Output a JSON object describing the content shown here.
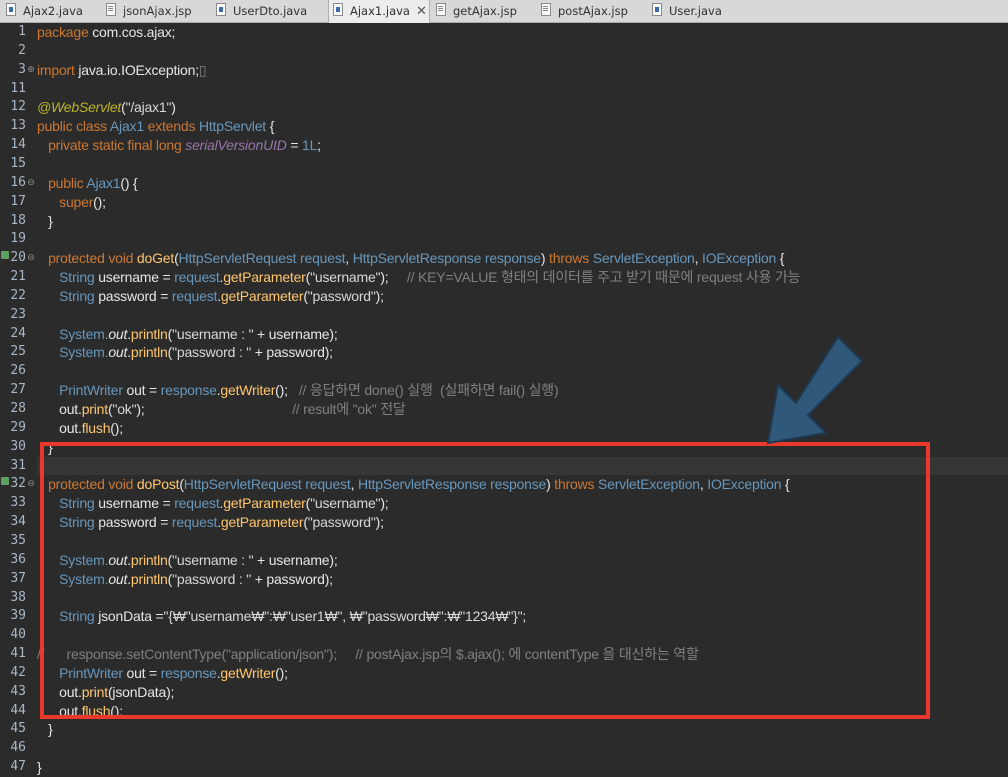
{
  "tabs": [
    {
      "label": "Ajax2.java",
      "icon": "java-file-icon",
      "active": false
    },
    {
      "label": "jsonAjax.jsp",
      "icon": "jsp-file-icon",
      "active": false
    },
    {
      "label": "UserDto.java",
      "icon": "java-file-icon",
      "active": false
    },
    {
      "label": "Ajax1.java",
      "icon": "java-file-icon",
      "active": true
    },
    {
      "label": "getAjax.jsp",
      "icon": "jsp-file-icon",
      "active": false
    },
    {
      "label": "postAjax.jsp",
      "icon": "jsp-file-icon",
      "active": false
    },
    {
      "label": "User.java",
      "icon": "java-file-icon",
      "active": false
    }
  ],
  "close_glyph": "✕",
  "editor": {
    "current_line": 31,
    "lines": [
      {
        "n": "1",
        "segs": [
          [
            "k",
            "package "
          ],
          [
            "v",
            "com.cos.ajax;"
          ]
        ]
      },
      {
        "n": "2",
        "segs": []
      },
      {
        "n": "3",
        "fold": "⊕",
        "segs": [
          [
            "k",
            "import "
          ],
          [
            "v",
            "java.io.IOException;"
          ],
          [
            "c",
            "▯"
          ]
        ]
      },
      {
        "n": "11",
        "segs": []
      },
      {
        "n": "12",
        "segs": [
          [
            "a",
            "@WebServlet"
          ],
          [
            "v",
            "("
          ],
          [
            "s",
            "\"/ajax1\""
          ],
          [
            "v",
            ")"
          ]
        ]
      },
      {
        "n": "13",
        "segs": [
          [
            "k",
            "public class "
          ],
          [
            "t",
            "Ajax1 "
          ],
          [
            "k",
            "extends "
          ],
          [
            "t",
            "HttpServlet "
          ],
          [
            "v",
            "{"
          ]
        ]
      },
      {
        "n": "14",
        "segs": [
          [
            "v",
            "   "
          ],
          [
            "k",
            "private static final long "
          ],
          [
            "f",
            "serialVersionUID"
          ],
          [
            "v",
            " = "
          ],
          [
            "t",
            "1L"
          ],
          [
            "v",
            ";"
          ]
        ]
      },
      {
        "n": "15",
        "segs": []
      },
      {
        "n": "16",
        "fold": "⊖",
        "segs": [
          [
            "v",
            "   "
          ],
          [
            "k",
            "public "
          ],
          [
            "t",
            "Ajax1"
          ],
          [
            "v",
            "() {"
          ]
        ]
      },
      {
        "n": "17",
        "segs": [
          [
            "v",
            "      "
          ],
          [
            "k",
            "super"
          ],
          [
            "v",
            "();"
          ]
        ]
      },
      {
        "n": "18",
        "segs": [
          [
            "v",
            "   }"
          ]
        ]
      },
      {
        "n": "19",
        "segs": []
      },
      {
        "n": "20",
        "fold": "⊖",
        "marker": true,
        "segs": [
          [
            "v",
            "   "
          ],
          [
            "k",
            "protected void "
          ],
          [
            "m",
            "doGet"
          ],
          [
            "v",
            "("
          ],
          [
            "t",
            "HttpServletRequest "
          ],
          [
            "t",
            "request"
          ],
          [
            "v",
            ", "
          ],
          [
            "t",
            "HttpServletResponse "
          ],
          [
            "t",
            "response"
          ],
          [
            "v",
            ") "
          ],
          [
            "k",
            "throws "
          ],
          [
            "t",
            "ServletException"
          ],
          [
            "v",
            ", "
          ],
          [
            "t",
            "IOException "
          ],
          [
            "v",
            "{"
          ]
        ]
      },
      {
        "n": "21",
        "segs": [
          [
            "v",
            "      "
          ],
          [
            "t",
            "String "
          ],
          [
            "v",
            "username = "
          ],
          [
            "t",
            "request"
          ],
          [
            "v",
            "."
          ],
          [
            "m",
            "getParameter"
          ],
          [
            "v",
            "("
          ],
          [
            "s",
            "\"username\""
          ],
          [
            "v",
            ");     "
          ],
          [
            "c",
            "// KEY=VALUE 형태의 데이터를 주고 받기 때문에 request 사용 가능"
          ]
        ]
      },
      {
        "n": "22",
        "segs": [
          [
            "v",
            "      "
          ],
          [
            "t",
            "String "
          ],
          [
            "v",
            "password = "
          ],
          [
            "t",
            "request"
          ],
          [
            "v",
            "."
          ],
          [
            "m",
            "getParameter"
          ],
          [
            "v",
            "("
          ],
          [
            "s",
            "\"password\""
          ],
          [
            "v",
            ");"
          ]
        ]
      },
      {
        "n": "23",
        "segs": []
      },
      {
        "n": "24",
        "segs": [
          [
            "v",
            "      "
          ],
          [
            "t",
            "System."
          ],
          [
            "st",
            "out"
          ],
          [
            "v",
            "."
          ],
          [
            "m",
            "println"
          ],
          [
            "v",
            "("
          ],
          [
            "s",
            "\"username : \""
          ],
          [
            "v",
            " + username);"
          ]
        ]
      },
      {
        "n": "25",
        "segs": [
          [
            "v",
            "      "
          ],
          [
            "t",
            "System."
          ],
          [
            "st",
            "out"
          ],
          [
            "v",
            "."
          ],
          [
            "m",
            "println"
          ],
          [
            "v",
            "("
          ],
          [
            "s",
            "\"password : \""
          ],
          [
            "v",
            " + password);"
          ]
        ]
      },
      {
        "n": "26",
        "segs": []
      },
      {
        "n": "27",
        "segs": [
          [
            "v",
            "      "
          ],
          [
            "t",
            "PrintWriter "
          ],
          [
            "v",
            "out = "
          ],
          [
            "t",
            "response"
          ],
          [
            "v",
            "."
          ],
          [
            "m",
            "getWriter"
          ],
          [
            "v",
            "();   "
          ],
          [
            "c",
            "// 응답하면 done() 실행  (실패하면 fail() 실행)"
          ]
        ]
      },
      {
        "n": "28",
        "segs": [
          [
            "v",
            "      out."
          ],
          [
            "m",
            "print"
          ],
          [
            "v",
            "("
          ],
          [
            "s",
            "\"ok\""
          ],
          [
            "v",
            ");                                        "
          ],
          [
            "c",
            "// result에 \"ok\" 전달"
          ]
        ]
      },
      {
        "n": "29",
        "segs": [
          [
            "v",
            "      out."
          ],
          [
            "m",
            "flush"
          ],
          [
            "v",
            "();"
          ]
        ]
      },
      {
        "n": "30",
        "segs": [
          [
            "v",
            "   }"
          ]
        ]
      },
      {
        "n": "31",
        "segs": []
      },
      {
        "n": "32",
        "fold": "⊖",
        "marker": true,
        "segs": [
          [
            "v",
            "   "
          ],
          [
            "k",
            "protected void "
          ],
          [
            "m",
            "doPost"
          ],
          [
            "v",
            "("
          ],
          [
            "t",
            "HttpServletRequest "
          ],
          [
            "t",
            "request"
          ],
          [
            "v",
            ", "
          ],
          [
            "t",
            "HttpServletResponse "
          ],
          [
            "t",
            "response"
          ],
          [
            "v",
            ") "
          ],
          [
            "k",
            "throws "
          ],
          [
            "t",
            "ServletException"
          ],
          [
            "v",
            ", "
          ],
          [
            "t",
            "IOException "
          ],
          [
            "v",
            "{"
          ]
        ]
      },
      {
        "n": "33",
        "segs": [
          [
            "v",
            "      "
          ],
          [
            "t",
            "String "
          ],
          [
            "v",
            "username = "
          ],
          [
            "t",
            "request"
          ],
          [
            "v",
            "."
          ],
          [
            "m",
            "getParameter"
          ],
          [
            "v",
            "("
          ],
          [
            "s",
            "\"username\""
          ],
          [
            "v",
            ");"
          ]
        ]
      },
      {
        "n": "34",
        "segs": [
          [
            "v",
            "      "
          ],
          [
            "t",
            "String "
          ],
          [
            "v",
            "password = "
          ],
          [
            "t",
            "request"
          ],
          [
            "v",
            "."
          ],
          [
            "m",
            "getParameter"
          ],
          [
            "v",
            "("
          ],
          [
            "s",
            "\"password\""
          ],
          [
            "v",
            ");"
          ]
        ]
      },
      {
        "n": "35",
        "segs": []
      },
      {
        "n": "36",
        "segs": [
          [
            "v",
            "      "
          ],
          [
            "t",
            "System."
          ],
          [
            "st",
            "out"
          ],
          [
            "v",
            "."
          ],
          [
            "m",
            "println"
          ],
          [
            "v",
            "("
          ],
          [
            "s",
            "\"username : \""
          ],
          [
            "v",
            " + username);"
          ]
        ]
      },
      {
        "n": "37",
        "segs": [
          [
            "v",
            "      "
          ],
          [
            "t",
            "System."
          ],
          [
            "st",
            "out"
          ],
          [
            "v",
            "."
          ],
          [
            "m",
            "println"
          ],
          [
            "v",
            "("
          ],
          [
            "s",
            "\"password : \""
          ],
          [
            "v",
            " + password);"
          ]
        ]
      },
      {
        "n": "38",
        "segs": []
      },
      {
        "n": "39",
        "segs": [
          [
            "v",
            "      "
          ],
          [
            "t",
            "String "
          ],
          [
            "v",
            "jsonData ="
          ],
          [
            "s",
            "\"{₩\"username₩\":₩\"user1₩\", ₩\"password₩\":₩\"1234₩\"}\""
          ],
          [
            "v",
            ";"
          ]
        ]
      },
      {
        "n": "40",
        "segs": []
      },
      {
        "n": "41",
        "segs": [
          [
            "c",
            "//      response.setContentType(\"application/json\");     // postAjax.jsp의 $.ajax(); 에 contentType 을 대신하는 역할"
          ]
        ]
      },
      {
        "n": "42",
        "segs": [
          [
            "v",
            "      "
          ],
          [
            "t",
            "PrintWriter "
          ],
          [
            "v",
            "out = "
          ],
          [
            "t",
            "response"
          ],
          [
            "v",
            "."
          ],
          [
            "m",
            "getWriter"
          ],
          [
            "v",
            "();"
          ]
        ]
      },
      {
        "n": "43",
        "segs": [
          [
            "v",
            "      out."
          ],
          [
            "m",
            "print"
          ],
          [
            "v",
            "(jsonData);"
          ]
        ]
      },
      {
        "n": "44",
        "segs": [
          [
            "v",
            "      out."
          ],
          [
            "m",
            "flush"
          ],
          [
            "v",
            "();"
          ]
        ]
      },
      {
        "n": "45",
        "segs": [
          [
            "v",
            "   }"
          ]
        ]
      },
      {
        "n": "46",
        "segs": []
      },
      {
        "n": "47",
        "segs": [
          [
            "v",
            "}"
          ]
        ]
      }
    ]
  },
  "annotation": {
    "box_color": "#e8392c",
    "arrow_color": "#2f5879",
    "arrow_outline": "#1e3a52"
  }
}
